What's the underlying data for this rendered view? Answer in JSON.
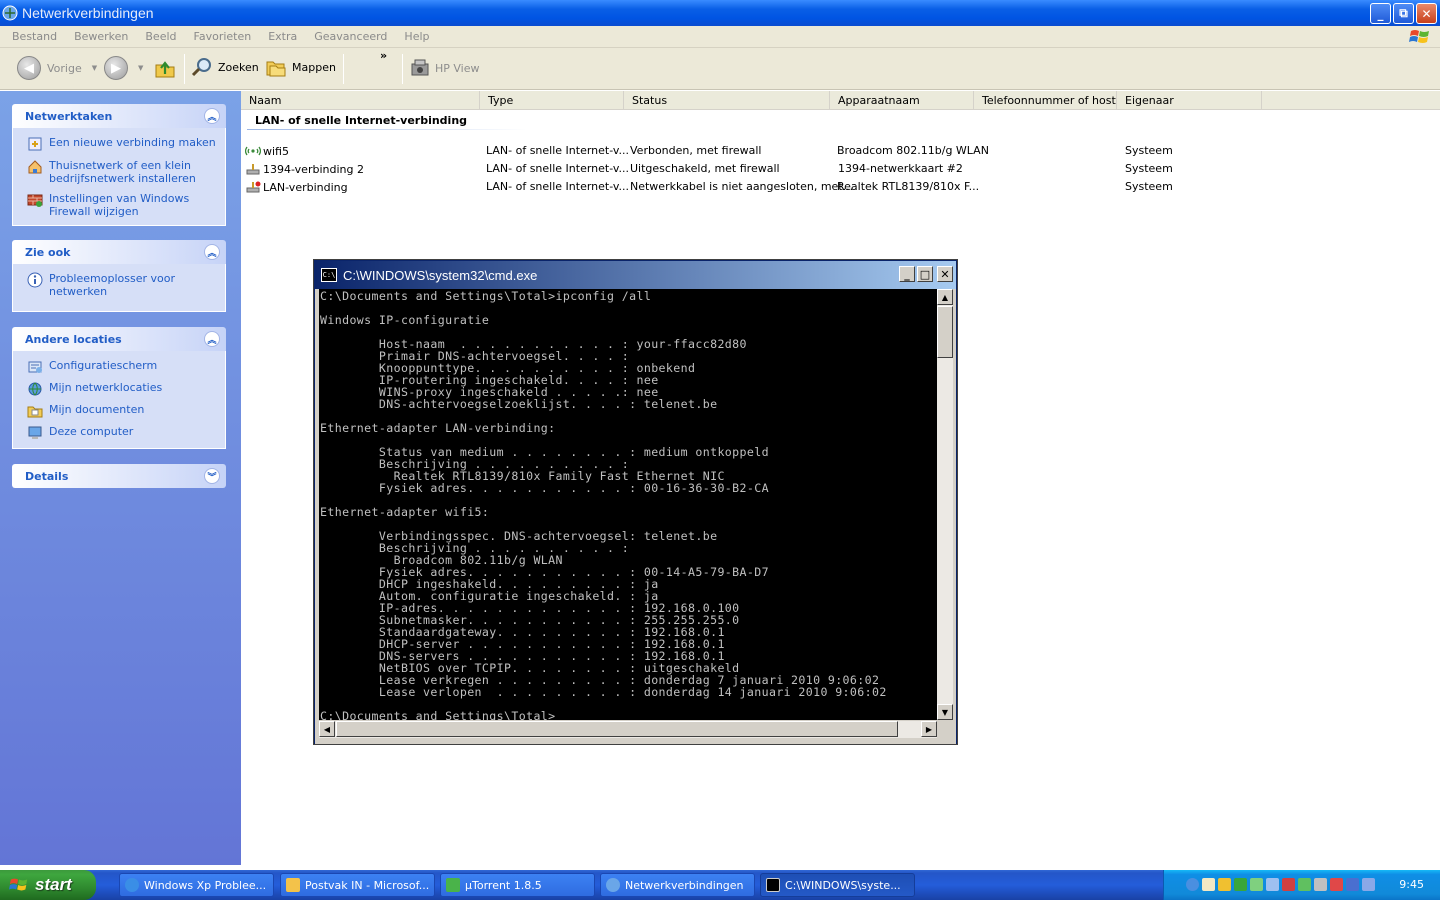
{
  "window": {
    "title": "Netwerkverbindingen",
    "minimize": "_",
    "restore": "⧉",
    "close": "✕"
  },
  "menu": [
    "Bestand",
    "Bewerken",
    "Beeld",
    "Favorieten",
    "Extra",
    "Geavanceerd",
    "Help"
  ],
  "toolbar": {
    "back": "Vorige",
    "search": "Zoeken",
    "folders": "Mappen",
    "more": "»",
    "hpview": "HP View"
  },
  "tasks": {
    "title": "Netwerktaken",
    "items": [
      "Een nieuwe verbinding maken",
      "Thuisnetwerk of een klein bedrijfsnetwerk installeren",
      "Instellingen van Windows Firewall wijzigen"
    ]
  },
  "see_also": {
    "title": "Zie ook",
    "items": [
      "Probleemoplosser voor netwerken"
    ]
  },
  "other_places": {
    "title": "Andere locaties",
    "items": [
      "Configuratiescherm",
      "Mijn netwerklocaties",
      "Mijn documenten",
      "Deze computer"
    ]
  },
  "details": {
    "title": "Details"
  },
  "columns": [
    "Naam",
    "Type",
    "Status",
    "Apparaatnaam",
    "Telefoonnummer of host...",
    "Eigenaar"
  ],
  "group_title": "LAN- of snelle Internet-verbinding",
  "connections": [
    {
      "name": "wifi5",
      "type": "LAN- of snelle Internet-v...",
      "status": "Verbonden, met firewall",
      "device": "Broadcom 802.11b/g WLAN",
      "owner": "Systeem"
    },
    {
      "name": "1394-verbinding 2",
      "type": "LAN- of snelle Internet-v...",
      "status": "Uitgeschakeld, met firewall",
      "device": "1394-netwerkkaart #2",
      "owner": "Systeem"
    },
    {
      "name": "LAN-verbinding",
      "type": "LAN- of snelle Internet-v...",
      "status": "Netwerkkabel is niet aangesloten, met...",
      "device": "Realtek RTL8139/810x F...",
      "owner": "Systeem"
    }
  ],
  "cmd": {
    "title": "C:\\WINDOWS\\system32\\cmd.exe",
    "icon_text": "C:\\",
    "lines": [
      "C:\\Documents and Settings\\Total>ipconfig /all",
      "",
      "Windows IP-configuratie",
      "",
      "        Host-naam  . . . . . . . . . . . : your-ffacc82d80",
      "        Primair DNS-achtervoegsel. . . . :",
      "        Knooppunttype. . . . . . . . . . : onbekend",
      "        IP-routering ingeschakeld. . . . : nee",
      "        WINS-proxy ingeschakeld . . . . .: nee",
      "        DNS-achtervoegselzoeklijst. . . . : telenet.be",
      "",
      "Ethernet-adapter LAN-verbinding:",
      "",
      "        Status van medium . . . . . . . . : medium ontkoppeld",
      "        Beschrijving . . . . . . . . . . :",
      "          Realtek RTL8139/810x Family Fast Ethernet NIC",
      "        Fysiek adres. . . . . . . . . . . : 00-16-36-30-B2-CA",
      "",
      "Ethernet-adapter wifi5:",
      "",
      "        Verbindingsspec. DNS-achtervoegsel: telenet.be",
      "        Beschrijving . . . . . . . . . . :",
      "          Broadcom 802.11b/g WLAN",
      "        Fysiek adres. . . . . . . . . . . : 00-14-A5-79-BA-D7",
      "        DHCP ingeshakeld. . . . . . . . . : ja",
      "        Autom. configuratie ingeschakeld. : ja",
      "        IP-adres. . . . . . . . . . . . . : 192.168.0.100",
      "        Subnetmasker. . . . . . . . . . . : 255.255.255.0",
      "        Standaardgateway. . . . . . . . . : 192.168.0.1",
      "        DHCP-server . . . . . . . . . . . : 192.168.0.1",
      "        DNS-servers . . . . . . . . . . . : 192.168.0.1",
      "        NetBIOS over TCPIP. . . . . . . . : uitgeschakeld",
      "        Lease verkregen . . . . . . . . . : donderdag 7 januari 2010 9:06:02",
      "        Lease verlopen  . . . . . . . . . : donderdag 14 januari 2010 9:06:02",
      "",
      "C:\\Documents and Settings\\Total>"
    ]
  },
  "taskbar": {
    "start": "start",
    "buttons": [
      "Windows Xp Problee...",
      "Postvak IN - Microsof...",
      "µTorrent 1.8.5",
      "Netwerkverbindingen",
      "C:\\WINDOWS\\syste..."
    ],
    "clock": "9:45"
  },
  "colors": {
    "xp_blue": "#0054e3",
    "task_link": "#215dc6",
    "start_green": "#3c9a3c",
    "tray_blue": "#118ad9"
  }
}
